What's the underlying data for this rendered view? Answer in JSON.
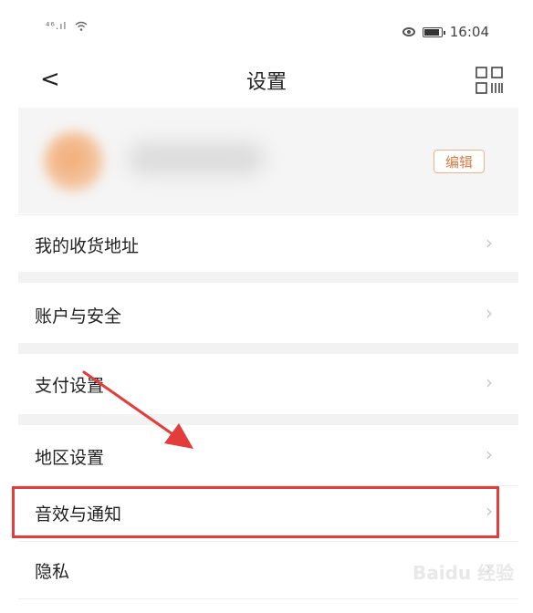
{
  "status_bar": {
    "signal": "⁴⁶.ıl",
    "time": "16:04"
  },
  "header": {
    "back_glyph": "<",
    "title": "设置"
  },
  "profile": {
    "edit_label": "编辑"
  },
  "menu": {
    "items": [
      {
        "label": "我的收货地址"
      },
      {
        "label": "账户与安全"
      },
      {
        "label": "支付设置"
      },
      {
        "label": "地区设置"
      },
      {
        "label": "音效与通知"
      },
      {
        "label": "隐私"
      }
    ],
    "chevron_glyph": "›"
  },
  "annotation": {
    "color": "#e43b3b"
  },
  "watermark": {
    "text": "Baidu 经验"
  },
  "colors": {
    "accent": "#e07b45",
    "highlight": "#e43b3b"
  }
}
